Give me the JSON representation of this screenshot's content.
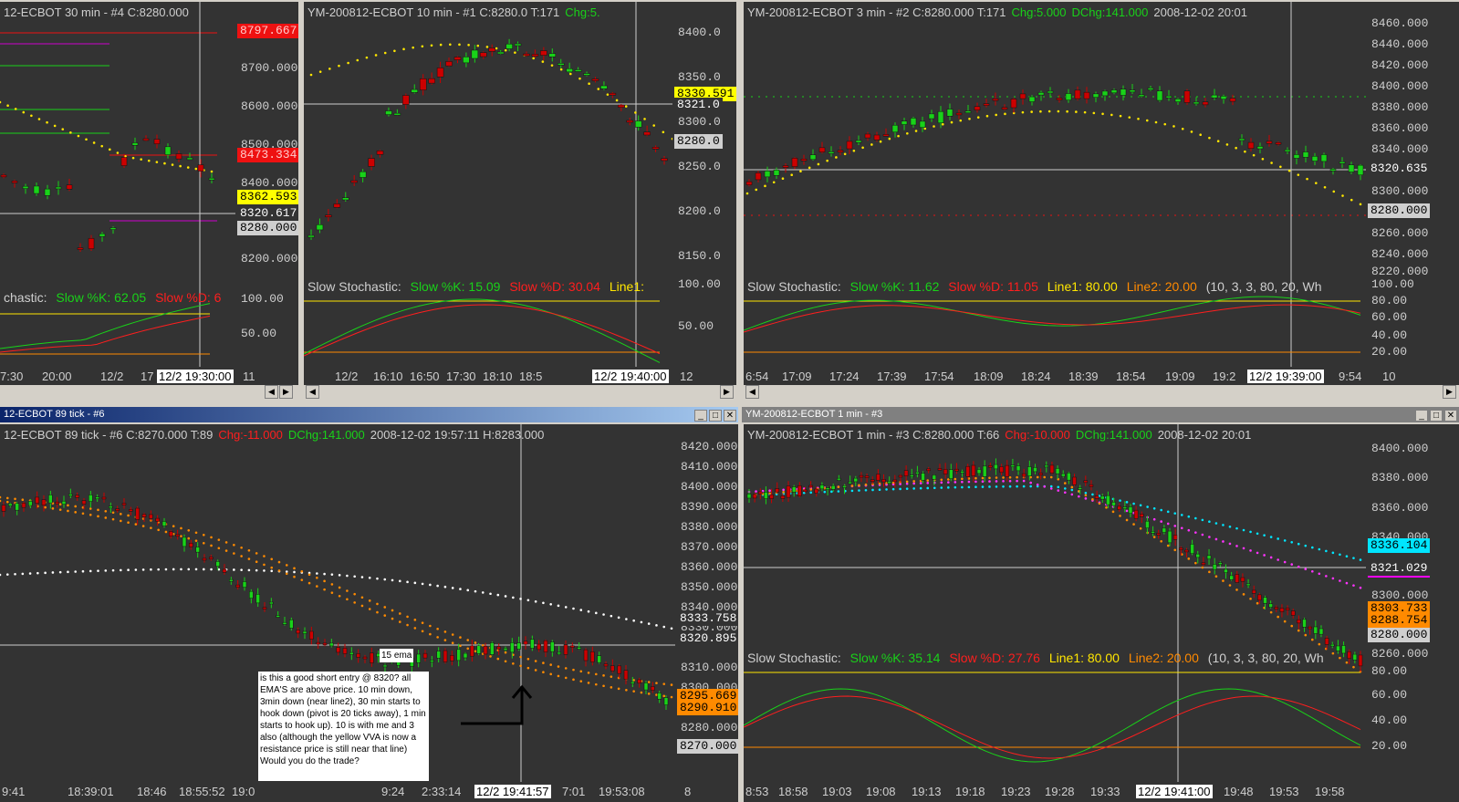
{
  "panes": {
    "p30": {
      "header": [
        "12-ECBOT 30 min  - #4  C:8280.000"
      ],
      "axis_ticks": [
        "8700.000",
        "8600.000",
        "8500.000",
        "8400.000",
        "8200.000",
        "100.00",
        "50.00"
      ],
      "tags": {
        "red_top": "8797.667",
        "red_mid": "8473.334",
        "yellow": "8362.593",
        "white": "8320.617",
        "gray": "8280.000"
      },
      "stoch": {
        "title": "chastic:",
        "k": "Slow %K: 62.05",
        "d": "Slow %D: 6"
      },
      "xlabels": [
        "7:30",
        "20:00",
        "12/2",
        "17"
      ],
      "xcursor": "12/2 19:30:00",
      "xright": "11"
    },
    "p10": {
      "header": [
        "YM-200812-ECBOT  10 min   - #1  C:8280.0  T:171",
        "Chg:5."
      ],
      "axis_ticks": [
        "8400.0",
        "8350.0",
        "8300.0",
        "8250.0",
        "8200.0",
        "8150.0",
        "100.00",
        "50.00"
      ],
      "tags": {
        "yellow": "8330.591",
        "white": "8321.0",
        "gray": "8280.0"
      },
      "stoch": {
        "title": "Slow Stochastic:",
        "k": "Slow %K: 15.09",
        "d": "Slow %D: 30.04",
        "l1": "Line1:"
      },
      "xlabels": [
        "12/2",
        "16:10",
        "16:50",
        "17:30",
        "18:10",
        "18:5"
      ],
      "xcursor": "12/2 19:40:00",
      "xright": "12"
    },
    "p3": {
      "header": [
        "YM-200812-ECBOT  3 min   - #2  C:8280.000  T:171",
        "Chg:5.000",
        "DChg:141.000",
        "2008-12-02  20:01"
      ],
      "axis_ticks": [
        "8460.000",
        "8440.000",
        "8420.000",
        "8400.000",
        "8380.000",
        "8360.000",
        "8340.000",
        "8300.000",
        "8260.000",
        "8240.000",
        "8220.000",
        "100.00",
        "80.00",
        "60.00",
        "40.00",
        "20.00"
      ],
      "tags": {
        "white": "8320.635",
        "gray": "8280.000"
      },
      "stoch": {
        "title": "Slow Stochastic:",
        "k": "Slow %K: 11.62",
        "d": "Slow %D: 11.05",
        "l1": "Line1: 80.00",
        "l2": "Line2: 20.00",
        "params": "(10, 3, 3, 80, 20, Wh"
      },
      "xlabels": [
        "6:54",
        "17:09",
        "17:24",
        "17:39",
        "17:54",
        "18:09",
        "18:24",
        "18:39",
        "18:54",
        "19:09",
        "19:2",
        "9:54"
      ],
      "xcursor": "12/2 19:39:00",
      "xright": "10"
    },
    "p89": {
      "title": "12-ECBOT  89 tick  - #6",
      "header": [
        "12-ECBOT  89 tick - #6  C:8270.000  T:89",
        "Chg:-11.000",
        "DChg:141.000",
        "2008-12-02  19:57:11  H:8283.000"
      ],
      "axis_ticks": [
        "8420.000",
        "8410.000",
        "8400.000",
        "8390.000",
        "8380.000",
        "8370.000",
        "8360.000",
        "8350.000",
        "8340.000",
        "8330.000",
        "8310.000",
        "8300.000",
        "8280.000"
      ],
      "tags": {
        "white1": "8333.758",
        "white2": "8320.895",
        "orange1": "8295.669",
        "orange2": "8290.910",
        "gray": "8270.000"
      },
      "ema_label": "15 ema",
      "note": "is this a good short entry @ 8320? all EMA'S are above price. 10 min down, 3min down (near line2), 30 min starts to hook down (pivot is 20 ticks away), 1 min starts to hook up). 10 is with me and 3 also (although the yellow VVA is now a resistance price is still near that line) Would you do the trade?",
      "xlabels": [
        "9:41",
        "18:39:01",
        "18:46",
        "18:55:52",
        "19:0",
        "9:24",
        "2:33:14",
        "7:01",
        "19:53:08"
      ],
      "xcursor": "12/2 19:41:57",
      "xright": "8"
    },
    "p1": {
      "title": "YM-200812-ECBOT  1 min  - #3",
      "header": [
        "YM-200812-ECBOT  1 min   - #3  C:8280.000  T:66",
        "Chg:-10.000",
        "DChg:141.000",
        "2008-12-02  20:01"
      ],
      "axis_ticks": [
        "8400.000",
        "8380.000",
        "8360.000",
        "8340.000",
        "8300.000",
        "8260.000",
        "80.00",
        "60.00",
        "40.00",
        "20.00"
      ],
      "tags": {
        "cyan": "8336.104",
        "white": "8321.029",
        "orange1": "8303.733",
        "orange2": "8288.754",
        "gray": "8280.000"
      },
      "stoch": {
        "title": "Slow Stochastic:",
        "k": "Slow %K: 35.14",
        "d": "Slow %D: 27.76",
        "l1": "Line1: 80.00",
        "l2": "Line2: 20.00",
        "params": "(10, 3, 3, 80, 20, Wh"
      },
      "xlabels": [
        "8:53",
        "18:58",
        "19:03",
        "19:08",
        "19:13",
        "19:18",
        "19:23",
        "19:28",
        "19:33",
        "19:48",
        "19:53",
        "19:58"
      ],
      "xcursor": "12/2 19:41:00",
      "xright": ""
    }
  },
  "colors": {
    "bg": "#333333",
    "up": "#19d219",
    "down": "#cc0000",
    "frame": "#d4d0c8",
    "titlebar_active": "#0a246a",
    "titlebar_inactive": "#808080"
  }
}
